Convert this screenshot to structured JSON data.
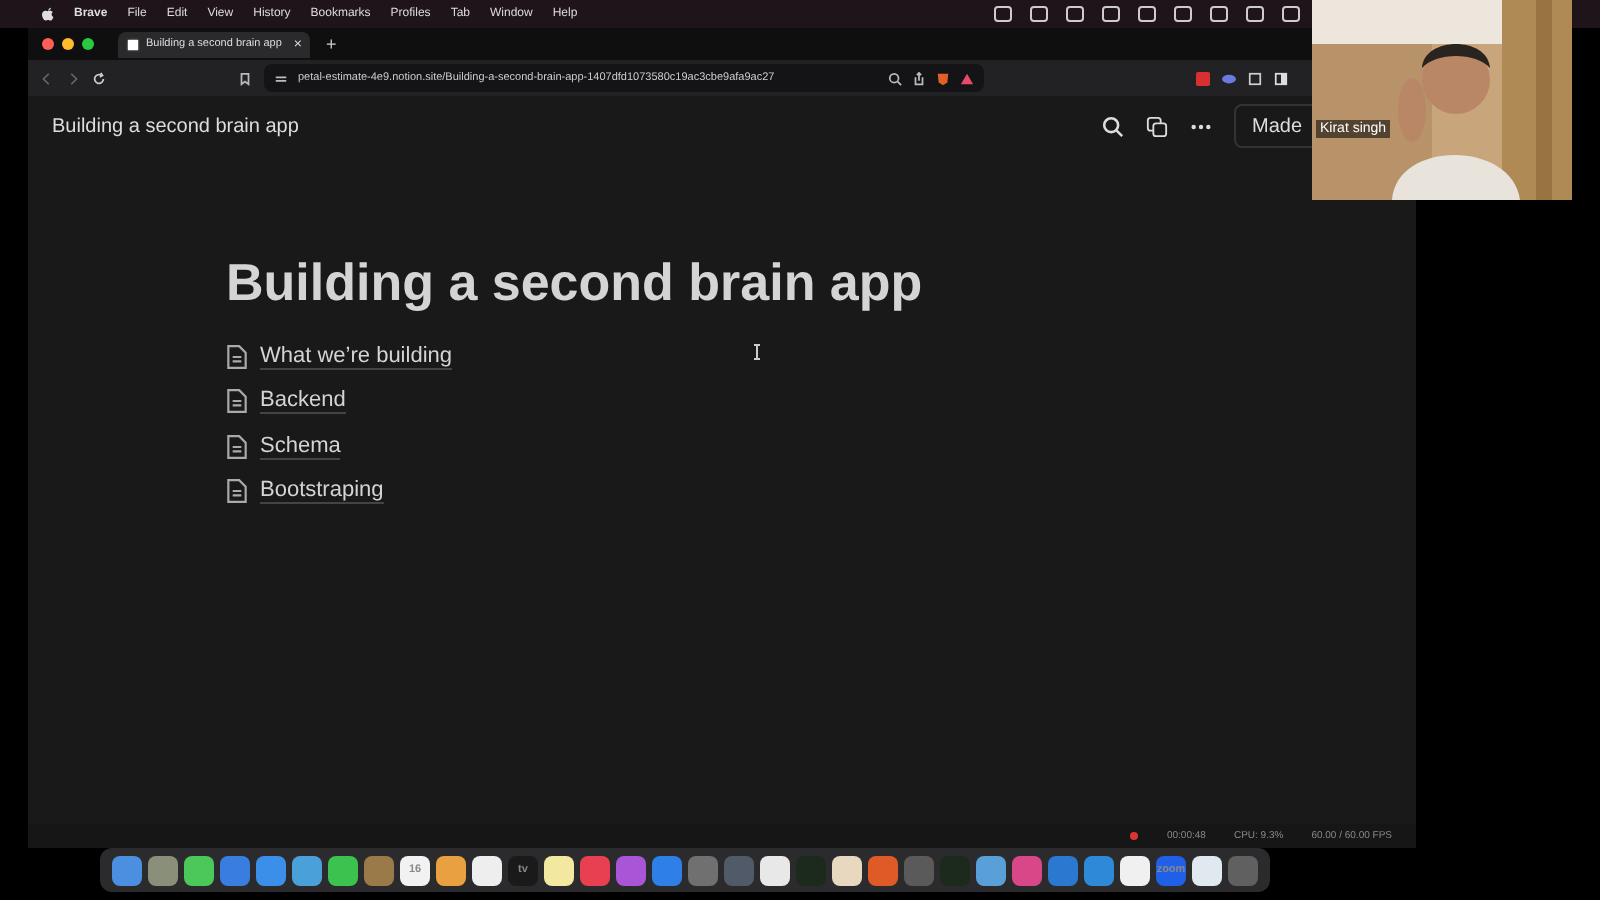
{
  "menubar": {
    "app": "Brave",
    "items": [
      "File",
      "Edit",
      "View",
      "History",
      "Bookmarks",
      "Profiles",
      "Tab",
      "Window",
      "Help"
    ]
  },
  "browser": {
    "tab": {
      "title": "Building a second brain app",
      "close": "×"
    },
    "new_tab": "+",
    "url": "petal-estimate-4e9.notion.site/Building-a-second-brain-app-1407dfd1073580c19ac3cbe9afa9ac27"
  },
  "notion": {
    "breadcrumb": "Building a second brain app",
    "made_button": "Made",
    "title": "Building a second brain app",
    "pages": [
      "What we’re building",
      "Backend",
      "Schema",
      "Bootstraping"
    ]
  },
  "status_bar": {
    "timer": "00:00:48",
    "cpu": "CPU: 9.3%",
    "fps": "60.00 / 60.00 FPS"
  },
  "webcam": {
    "name": "Kirat singh"
  },
  "dock": [
    {
      "color": "#4a8fe0"
    },
    {
      "color": "#8a8f7a"
    },
    {
      "color": "#4cc75a"
    },
    {
      "color": "#3a7de0"
    },
    {
      "color": "#3b8fe8"
    },
    {
      "color": "#4aa0d8"
    },
    {
      "color": "#3cc24e"
    },
    {
      "color": "#9a7a48"
    },
    {
      "color": "#f2f2f2",
      "label": "16"
    },
    {
      "color": "#e8a040"
    },
    {
      "color": "#eeeeee"
    },
    {
      "color": "#1a1a1a",
      "label": "tv"
    },
    {
      "color": "#f2e8a0"
    },
    {
      "color": "#e84050"
    },
    {
      "color": "#a855d8"
    },
    {
      "color": "#2f7fe8"
    },
    {
      "color": "#707070"
    },
    {
      "color": "#505a68"
    },
    {
      "color": "#e8e8e8"
    },
    {
      "color": "#1c2a1e"
    },
    {
      "color": "#e8d8c0"
    },
    {
      "color": "#e05a28"
    },
    {
      "color": "#5a5a5a"
    },
    {
      "color": "#1c2a1e"
    },
    {
      "color": "#5aa0d8"
    },
    {
      "color": "#d84888"
    },
    {
      "color": "#2a78d0"
    },
    {
      "color": "#2e8ad8"
    },
    {
      "color": "#f0f0f0"
    },
    {
      "color": "#2060e8",
      "label": "zoom"
    },
    {
      "color": "#e0e8f0"
    },
    {
      "color": "#606060"
    }
  ]
}
